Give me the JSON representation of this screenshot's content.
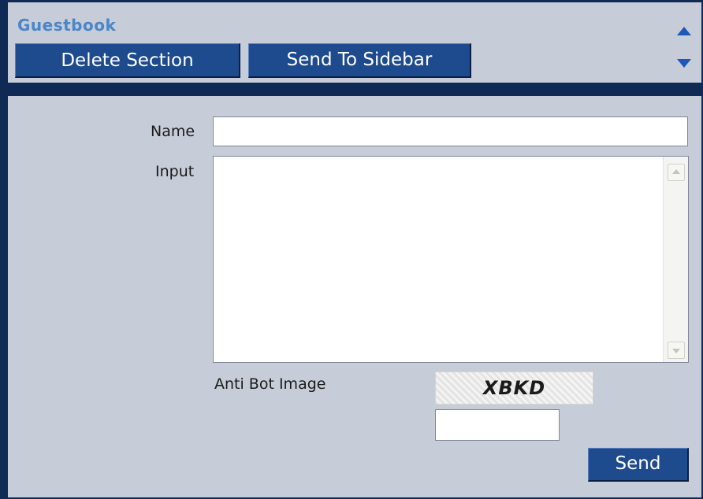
{
  "header": {
    "title": "Guestbook",
    "delete_label": "Delete Section",
    "sidebar_label": "Send To Sidebar"
  },
  "form": {
    "name_label": "Name",
    "name_value": "",
    "input_label": "Input",
    "input_value": "",
    "antibot_label": "Anti Bot Image",
    "captcha_text": "XBKD",
    "captcha_value": "",
    "send_label": "Send"
  },
  "icons": {
    "move_up": "arrow-up-icon",
    "move_down": "arrow-down-icon",
    "scroll_up": "scroll-up-icon",
    "scroll_down": "scroll-down-icon"
  },
  "colors": {
    "frame": "#0f2a55",
    "panel": "#c6ccd8",
    "button": "#1e4a8e",
    "title": "#4a86c8",
    "arrow": "#1d58b8"
  }
}
